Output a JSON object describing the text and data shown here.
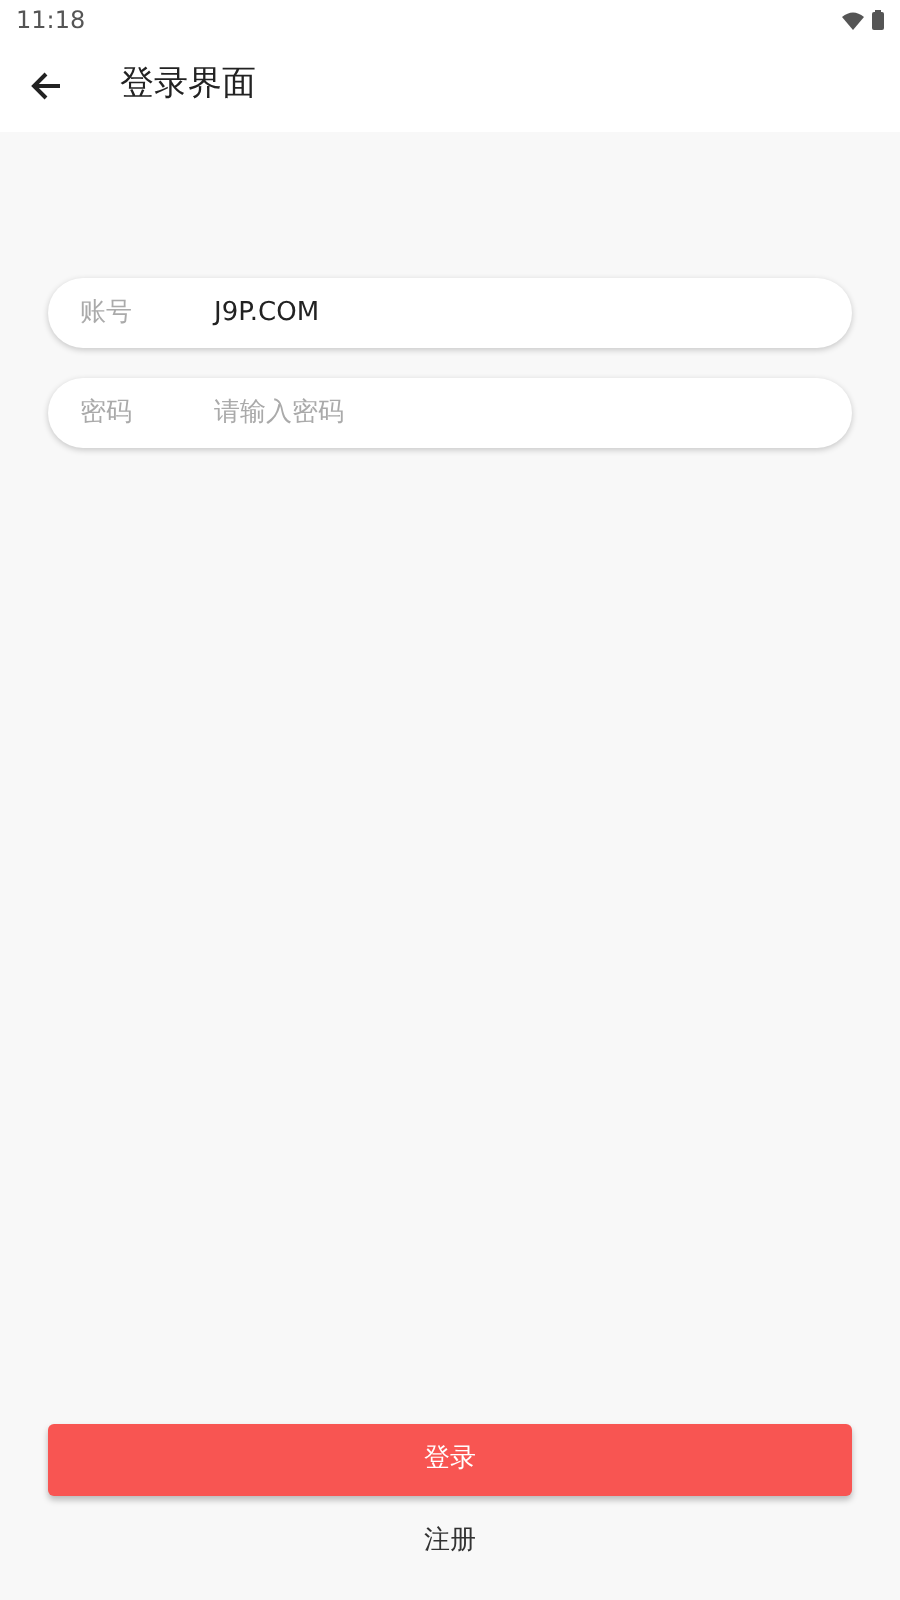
{
  "status_bar": {
    "time": "11:18"
  },
  "app_bar": {
    "title": "登录界面"
  },
  "fields": [
    {
      "label": "账号",
      "value": "J9P.COM"
    },
    {
      "label": "密码",
      "placeholder": "请输入密码"
    }
  ],
  "login_button": "登录",
  "register_link": "注册"
}
